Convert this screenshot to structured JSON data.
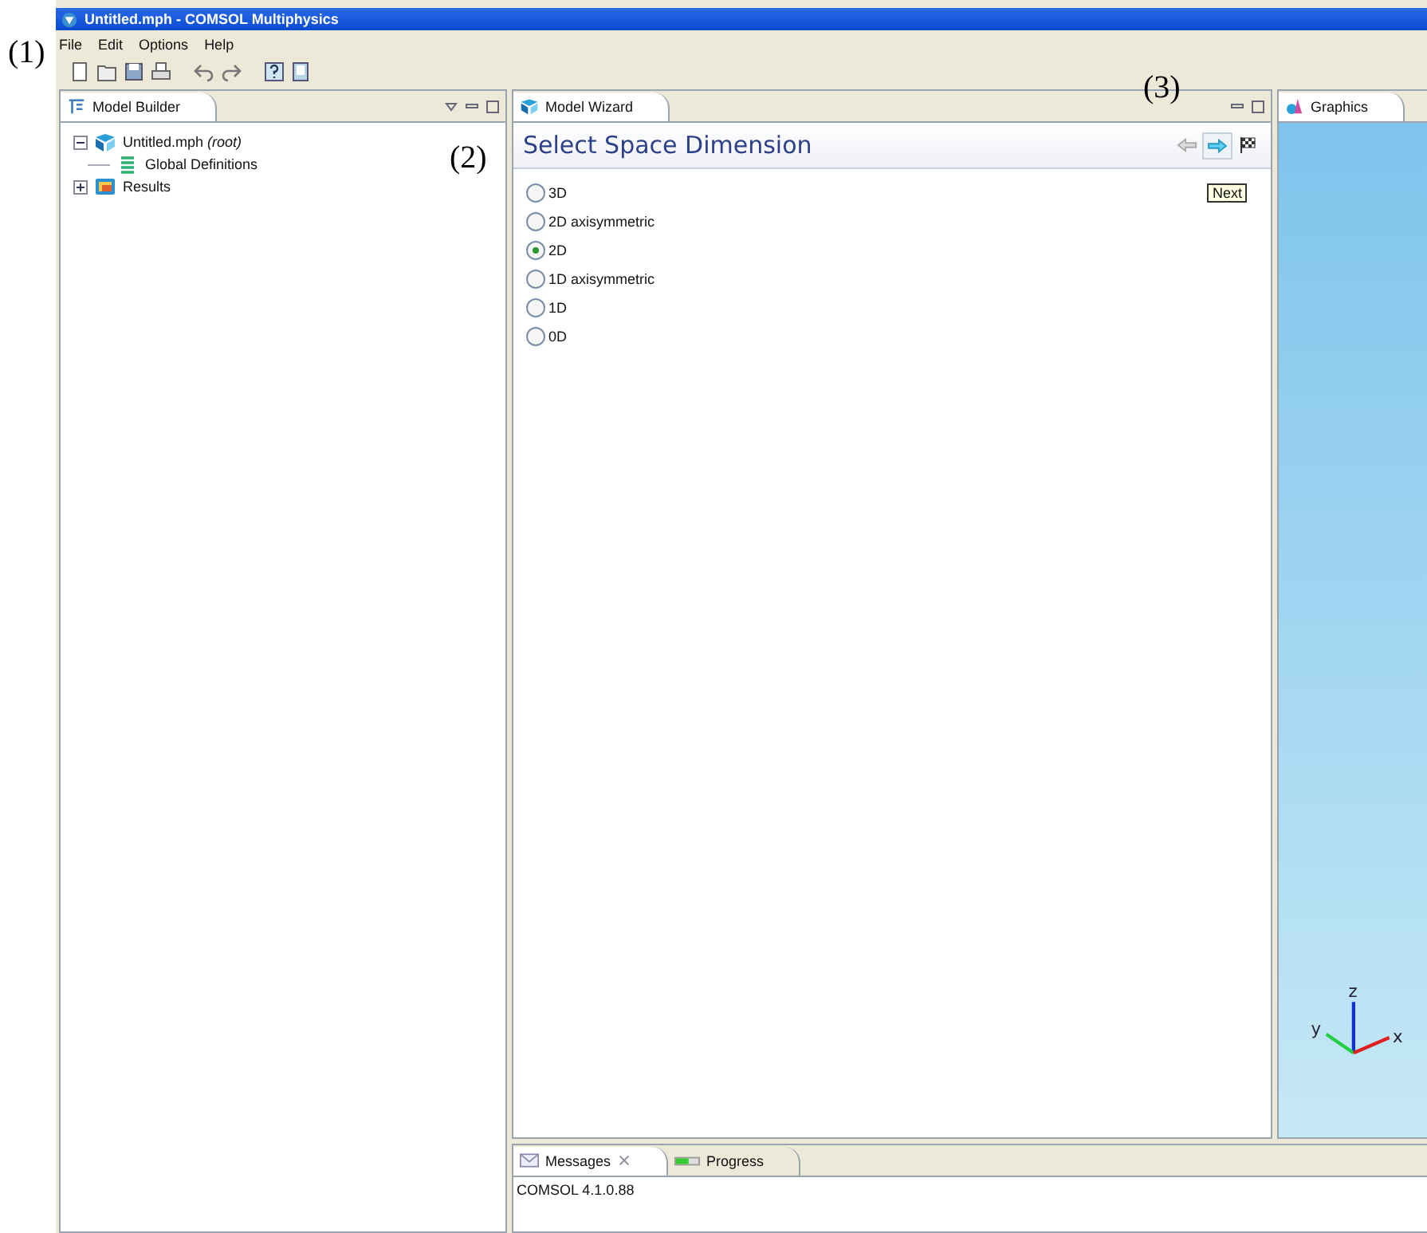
{
  "window": {
    "title": "Untitled.mph - COMSOL Multiphysics"
  },
  "menu": [
    "File",
    "Edit",
    "Options",
    "Help"
  ],
  "model_builder": {
    "tab": "Model Builder",
    "tree": [
      {
        "label": "Untitled.mph *(root)*",
        "expanded": true,
        "children": [
          {
            "label": "Global Definitions",
            "kind": "definitions"
          },
          {
            "label": "Results",
            "kind": "results",
            "expanded": false
          }
        ]
      }
    ]
  },
  "model_wizard": {
    "tab": "Model Wizard",
    "heading": "Select Space Dimension",
    "tooltip": "Next",
    "options": [
      {
        "label": "3D",
        "selected": false
      },
      {
        "label": "2D axisymmetric",
        "selected": false
      },
      {
        "label": "2D",
        "selected": true
      },
      {
        "label": "1D axisymmetric",
        "selected": false
      },
      {
        "label": "1D",
        "selected": false
      },
      {
        "label": "0D",
        "selected": false
      }
    ]
  },
  "graphics": {
    "tab": "Graphics",
    "axes": [
      "z",
      "y",
      "x"
    ]
  },
  "messages": {
    "tabs": [
      {
        "label": "Messages",
        "selected": true
      },
      {
        "label": "Progress",
        "selected": false
      }
    ],
    "text": "COMSOL 4.1.0.88"
  },
  "annotations": [
    "(1)",
    "(2)",
    "(3)"
  ]
}
